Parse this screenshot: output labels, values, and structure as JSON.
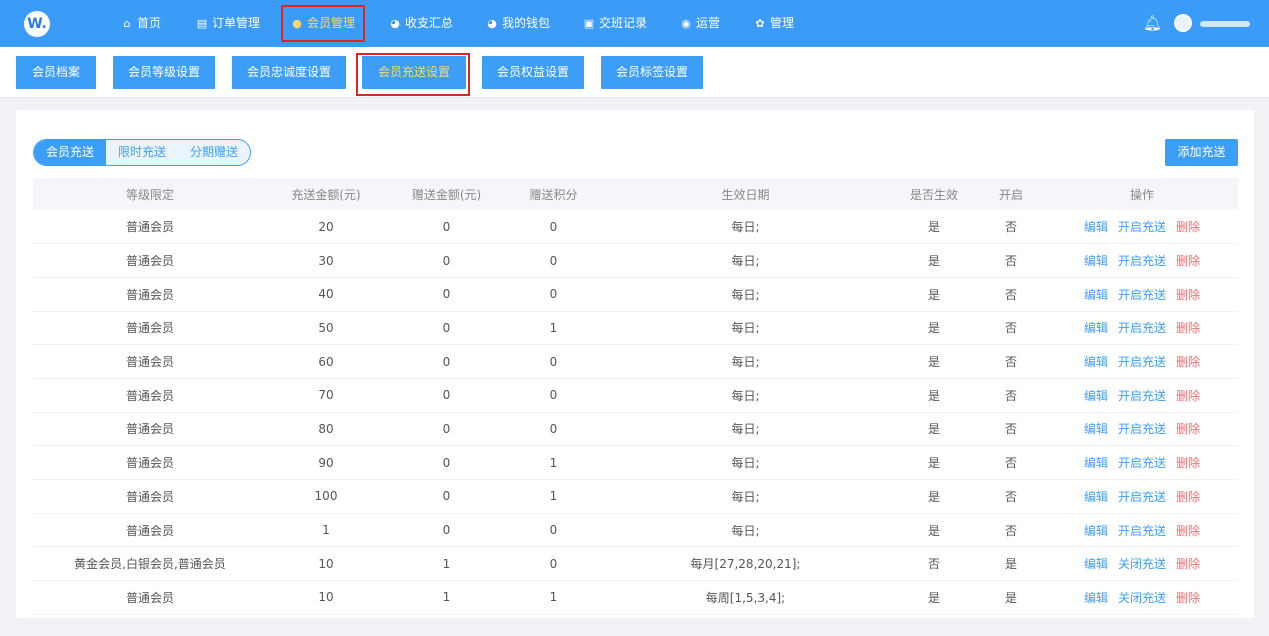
{
  "brand": {
    "logo_text": "W."
  },
  "topnav": {
    "items": [
      {
        "label": "首页",
        "icon": "home-icon",
        "glyph": "⌂"
      },
      {
        "label": "订单管理",
        "icon": "order-icon",
        "glyph": "▤"
      },
      {
        "label": "会员管理",
        "icon": "user-icon",
        "glyph": "●",
        "active": true
      },
      {
        "label": "收支汇总",
        "icon": "pie-icon",
        "glyph": "◕"
      },
      {
        "label": "我的钱包",
        "icon": "wallet-pie-icon",
        "glyph": "◕"
      },
      {
        "label": "交班记录",
        "icon": "camera-icon",
        "glyph": "▣"
      },
      {
        "label": "运营",
        "icon": "circle-dot-icon",
        "glyph": "◉"
      },
      {
        "label": "管理",
        "icon": "gear-icon",
        "glyph": "✿"
      }
    ],
    "bell_glyph": "🔔︎"
  },
  "subnav": {
    "items": [
      {
        "label": "会员档案"
      },
      {
        "label": "会员等级设置"
      },
      {
        "label": "会员忠诚度设置"
      },
      {
        "label": "会员充送设置",
        "active": true
      },
      {
        "label": "会员权益设置"
      },
      {
        "label": "会员标签设置"
      }
    ]
  },
  "segment": {
    "tabs": [
      "会员充送",
      "限时充送",
      "分期赠送"
    ],
    "active": 0
  },
  "add_button": "添加充送",
  "table": {
    "headers": [
      "等级限定",
      "充送金额(元)",
      "赠送金额(元)",
      "赠送积分",
      "生效日期",
      "是否生效",
      "开启",
      "操作"
    ],
    "rows": [
      [
        "普通会员",
        "20",
        "0",
        "0",
        "每日;",
        "是",
        "否",
        [
          "编辑",
          "开启充送",
          "删除"
        ]
      ],
      [
        "普通会员",
        "30",
        "0",
        "0",
        "每日;",
        "是",
        "否",
        [
          "编辑",
          "开启充送",
          "删除"
        ]
      ],
      [
        "普通会员",
        "40",
        "0",
        "0",
        "每日;",
        "是",
        "否",
        [
          "编辑",
          "开启充送",
          "删除"
        ]
      ],
      [
        "普通会员",
        "50",
        "0",
        "1",
        "每日;",
        "是",
        "否",
        [
          "编辑",
          "开启充送",
          "删除"
        ]
      ],
      [
        "普通会员",
        "60",
        "0",
        "0",
        "每日;",
        "是",
        "否",
        [
          "编辑",
          "开启充送",
          "删除"
        ]
      ],
      [
        "普通会员",
        "70",
        "0",
        "0",
        "每日;",
        "是",
        "否",
        [
          "编辑",
          "开启充送",
          "删除"
        ]
      ],
      [
        "普通会员",
        "80",
        "0",
        "0",
        "每日;",
        "是",
        "否",
        [
          "编辑",
          "开启充送",
          "删除"
        ]
      ],
      [
        "普通会员",
        "90",
        "0",
        "1",
        "每日;",
        "是",
        "否",
        [
          "编辑",
          "开启充送",
          "删除"
        ]
      ],
      [
        "普通会员",
        "100",
        "0",
        "1",
        "每日;",
        "是",
        "否",
        [
          "编辑",
          "开启充送",
          "删除"
        ]
      ],
      [
        "普通会员",
        "1",
        "0",
        "0",
        "每日;",
        "是",
        "否",
        [
          "编辑",
          "开启充送",
          "删除"
        ]
      ],
      [
        "黄金会员,白银会员,普通会员",
        "10",
        "1",
        "0",
        "每月[27,28,20,21];",
        "否",
        "是",
        [
          "编辑",
          "关闭充送",
          "删除"
        ]
      ],
      [
        "普通会员",
        "10",
        "1",
        "1",
        "每周[1,5,3,4];",
        "是",
        "是",
        [
          "编辑",
          "关闭充送",
          "删除"
        ]
      ]
    ]
  },
  "colors": {
    "primary": "#3b9cf7",
    "active_text": "#ffd76a",
    "highlight_box": "#e02424",
    "delete": "#f56c6c"
  }
}
